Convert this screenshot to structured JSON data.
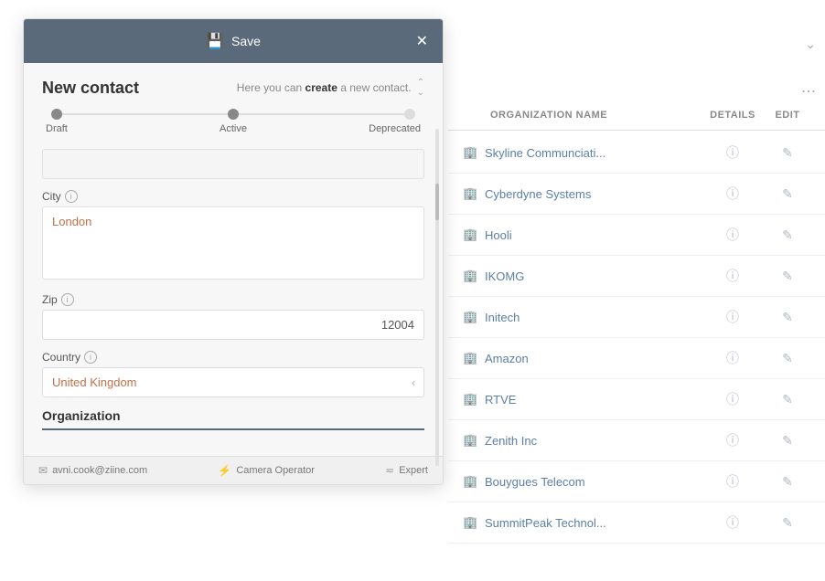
{
  "modal": {
    "header": {
      "save_label": "Save",
      "close_label": "✕",
      "save_icon": "💾"
    },
    "title": "New contact",
    "hint_prefix": "Here you can ",
    "hint_action": "create",
    "hint_suffix": " a new contact.",
    "progress": {
      "steps": [
        "Draft",
        "Active",
        "Deprecated"
      ]
    },
    "fields": {
      "city_label": "City",
      "city_value": "London",
      "zip_label": "Zip",
      "zip_value": "12004",
      "country_label": "Country",
      "country_value": "United Kingdom"
    },
    "organization": {
      "section_title": "Organization"
    },
    "footer": {
      "email": "avni.cook@ziine.com",
      "role": "Camera Operator",
      "level": "Expert"
    }
  },
  "table": {
    "columns": {
      "org_name": "ORGANIZATION NAME",
      "details": "DETAILS",
      "edit": "EDIT"
    },
    "rows": [
      {
        "name": "Skyline Communciati...",
        "id": 1
      },
      {
        "name": "Cyberdyne Systems",
        "id": 2
      },
      {
        "name": "Hooli",
        "id": 3
      },
      {
        "name": "IKOMG",
        "id": 4
      },
      {
        "name": "Initech",
        "id": 5
      },
      {
        "name": "Amazon",
        "id": 6
      },
      {
        "name": "RTVE",
        "id": 7
      },
      {
        "name": "Zenith Inc",
        "id": 8
      },
      {
        "name": "Bouygues Telecom",
        "id": 9
      },
      {
        "name": "SummitPeak Technol...",
        "id": 10
      }
    ]
  },
  "colors": {
    "header_bg": "#5a6a7a",
    "accent_blue": "#5b7fa6",
    "org_purple": "#c0a0c0",
    "text_orange": "#c0704a"
  }
}
